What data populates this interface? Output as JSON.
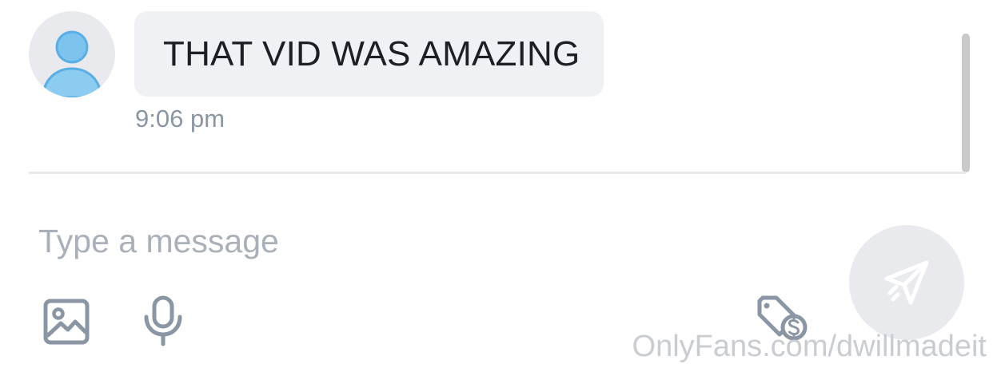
{
  "conversation": {
    "messages": [
      {
        "sender_avatar": "default-user-avatar",
        "text": "THAT VID WAS AMAZING",
        "time": "9:06 pm"
      }
    ]
  },
  "composer": {
    "placeholder": "Type a message",
    "value": "",
    "icons": {
      "media": "image-icon",
      "voice": "microphone-icon",
      "price": "price-tag-dollar-icon",
      "send": "paper-plane-send-icon"
    }
  },
  "watermark": "OnlyFans.com/dwillmadeit",
  "colors": {
    "bubble_background": "#f0f1f4",
    "timestamp_text": "#8a96a3",
    "icon_gray": "#8a96a3",
    "send_button_background": "#e9eaee",
    "avatar_blue": "#6fbff0"
  }
}
